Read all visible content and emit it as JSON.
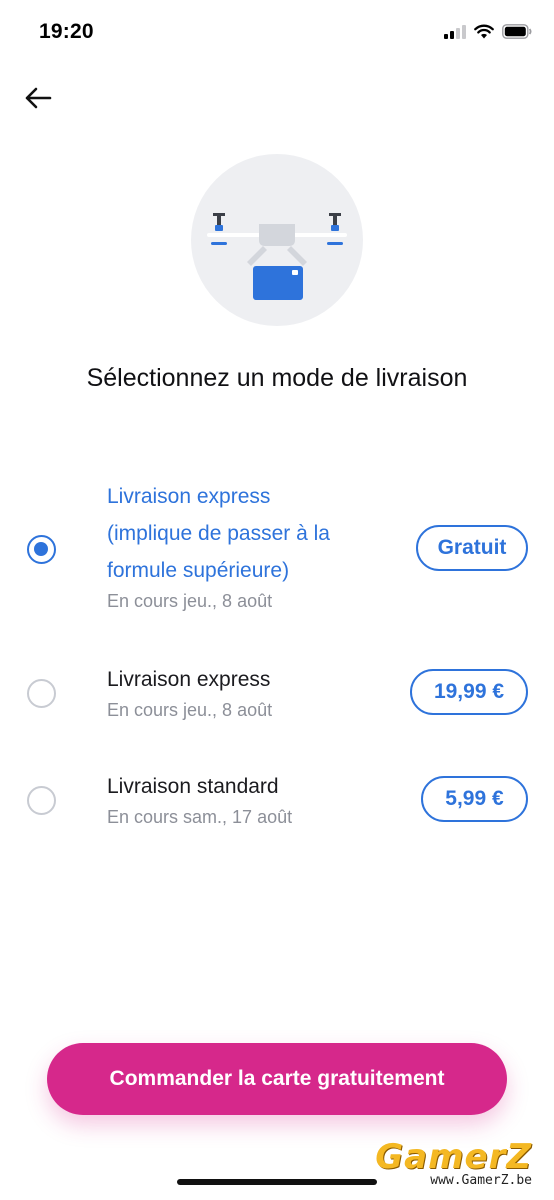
{
  "status_bar": {
    "time": "19:20",
    "icons": [
      "cellular-signal-icon",
      "wifi-icon",
      "battery-icon"
    ]
  },
  "header": {
    "back_icon": "arrow-left-icon"
  },
  "hero": {
    "icon": "delivery-drone-illustration"
  },
  "title": "Sélectionnez un mode de livraison",
  "options": [
    {
      "title_lines": [
        "Livraison express",
        "(implique de passer à la",
        "formule supérieure)"
      ],
      "subtitle": "En cours jeu., 8 août",
      "price": "Gratuit",
      "selected": true
    },
    {
      "title_lines": [
        "Livraison express"
      ],
      "subtitle": "En cours jeu., 8 août",
      "price": "19,99 €",
      "selected": false
    },
    {
      "title_lines": [
        "Livraison standard"
      ],
      "subtitle": "En cours sam., 17 août",
      "price": "5,99 €",
      "selected": false
    }
  ],
  "cta_label": "Commander la carte gratuitement",
  "watermark": {
    "logo": "GamerZ",
    "url": "www.GamerZ.be"
  },
  "colors": {
    "accent": "#2e73db",
    "cta": "#d6288b",
    "watermark": "#f4b823"
  }
}
